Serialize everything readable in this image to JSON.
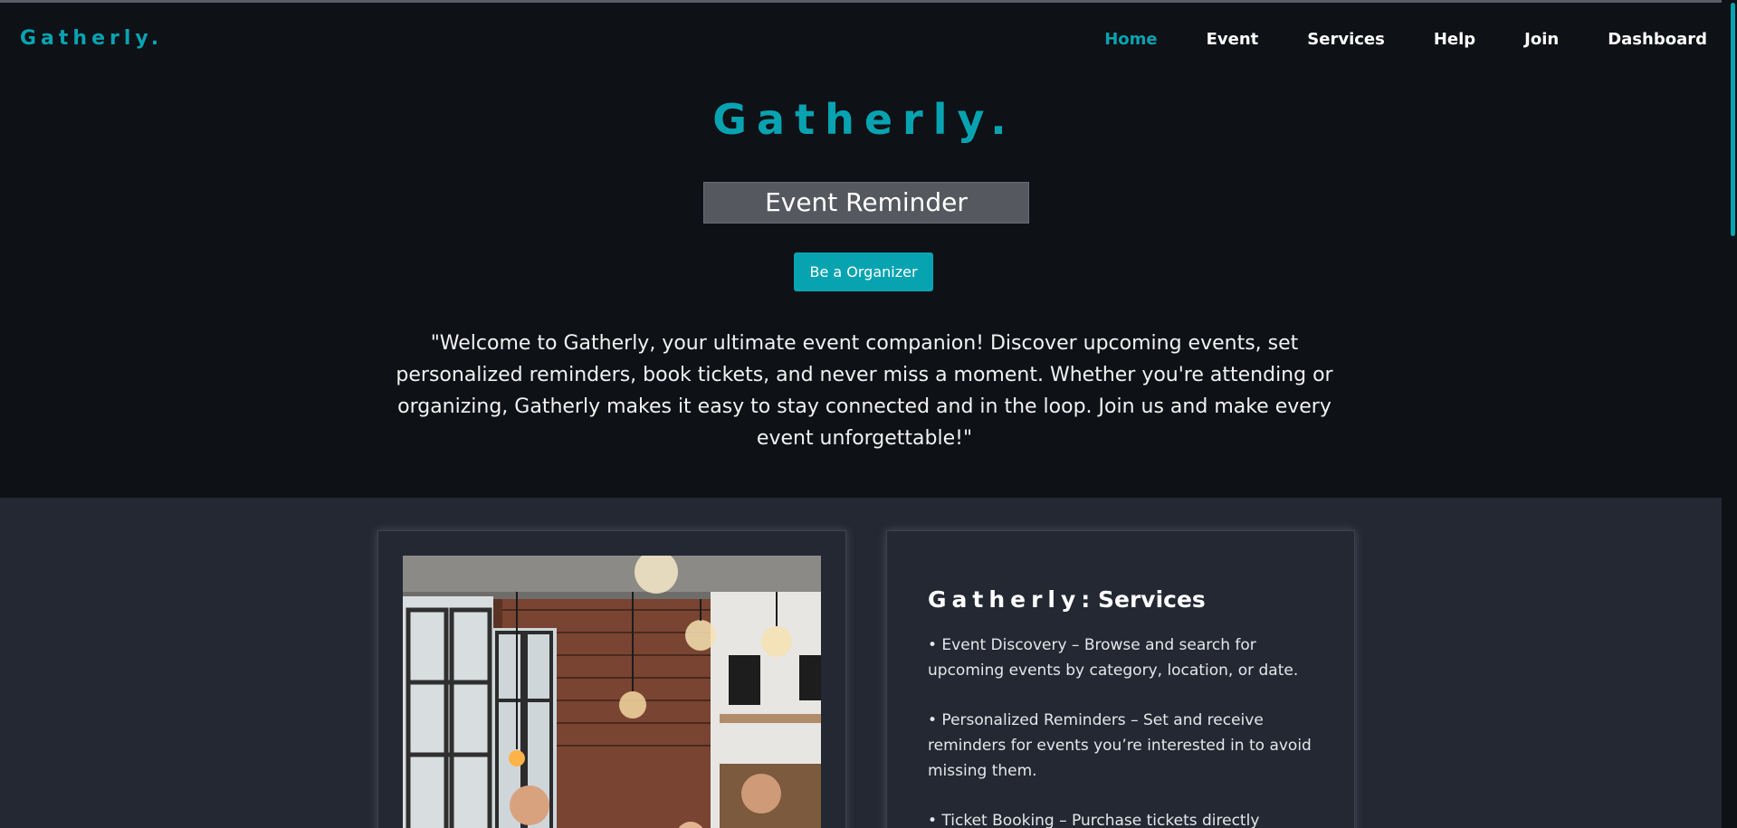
{
  "brand": {
    "logo_text": "Gatherly.",
    "accent_color": "#08a3b1"
  },
  "nav": {
    "items": [
      {
        "label": "Home",
        "active": true
      },
      {
        "label": "Event",
        "active": false
      },
      {
        "label": "Services",
        "active": false
      },
      {
        "label": "Help",
        "active": false
      },
      {
        "label": "Join",
        "active": false
      },
      {
        "label": "Dashboard",
        "active": false
      }
    ]
  },
  "hero": {
    "title": "Gatherly.",
    "subtitle": "Event Reminder",
    "cta_label": "Be a Organizer",
    "intro": "\"Welcome to Gatherly, your ultimate event companion! Discover upcoming events, set personalized reminders, book tickets, and never miss a moment. Whether you're attending or organizing, Gatherly makes it easy to stay connected and in the loop. Join us and make every event unforgettable!\""
  },
  "services": {
    "title_brand": "Gatherly",
    "title_suffix": ": Services",
    "items": [
      "• Event Discovery – Browse and search for upcoming events by category, location, or date.",
      "• Personalized Reminders – Set and receive reminders for events you’re interested in to avoid missing them.",
      "• Ticket Booking – Purchase tickets directly"
    ]
  },
  "image": {
    "subject": "event-photo"
  },
  "icons": {
    "scrollbar": "scrollbar-thumb"
  }
}
